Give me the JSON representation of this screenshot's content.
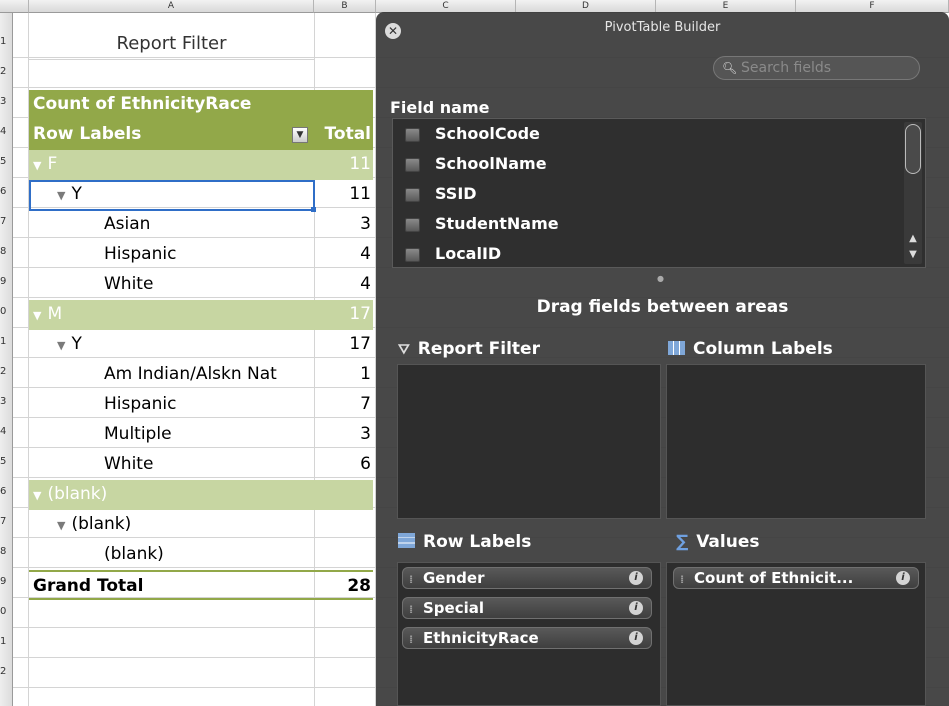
{
  "columns": [
    "A",
    "B",
    "C",
    "D",
    "E",
    "F"
  ],
  "row_numbers": [
    "1",
    "2",
    "3",
    "4",
    "5",
    "6",
    "7",
    "8",
    "9",
    "0",
    "1",
    "2",
    "3",
    "4",
    "5",
    "6",
    "7",
    "8",
    "9",
    "0",
    "1",
    "2"
  ],
  "report_filter_cell": "Report Filter",
  "pivot": {
    "header": "Count of EthnicityRace",
    "row_labels": "Row Labels",
    "total_header": "Total",
    "rows": [
      {
        "label": "F",
        "value": "11",
        "level": 0
      },
      {
        "label": "Y",
        "value": "11",
        "level": 1
      },
      {
        "label": "Asian",
        "value": "3",
        "level": 2
      },
      {
        "label": "Hispanic",
        "value": "4",
        "level": 2
      },
      {
        "label": "White",
        "value": "4",
        "level": 2
      },
      {
        "label": "M",
        "value": "17",
        "level": 0
      },
      {
        "label": "Y",
        "value": "17",
        "level": 1
      },
      {
        "label": "Am Indian/Alskn Nat",
        "value": "1",
        "level": 2
      },
      {
        "label": "Hispanic",
        "value": "7",
        "level": 2
      },
      {
        "label": "Multiple",
        "value": "3",
        "level": 2
      },
      {
        "label": "White",
        "value": "6",
        "level": 2
      },
      {
        "label": "(blank)",
        "value": "",
        "level": 0
      },
      {
        "label": "(blank)",
        "value": "",
        "level": 1
      },
      {
        "label": "(blank)",
        "value": "",
        "level": 2
      }
    ],
    "grand_total_label": "Grand Total",
    "grand_total_value": "28"
  },
  "builder": {
    "title": "PivotTable Builder",
    "search_placeholder": "Search fields",
    "field_name_label": "Field name",
    "fields": [
      "SchoolCode",
      "SchoolName",
      "SSID",
      "StudentName",
      "LocalID"
    ],
    "drag_title": "Drag fields between areas",
    "areas": {
      "report_filter": "Report Filter",
      "column_labels": "Column Labels",
      "row_labels": "Row Labels",
      "values": "Values"
    },
    "row_label_fields": [
      "Gender",
      "Special",
      "EthnicityRace"
    ],
    "value_fields": [
      "Count of Ethnicit..."
    ]
  },
  "colors": {
    "pivot_header": "#92a849",
    "pivot_subheader": "#c7d6a2",
    "panel_bg": "#3a3a3a",
    "selection": "#2f6ec7"
  }
}
